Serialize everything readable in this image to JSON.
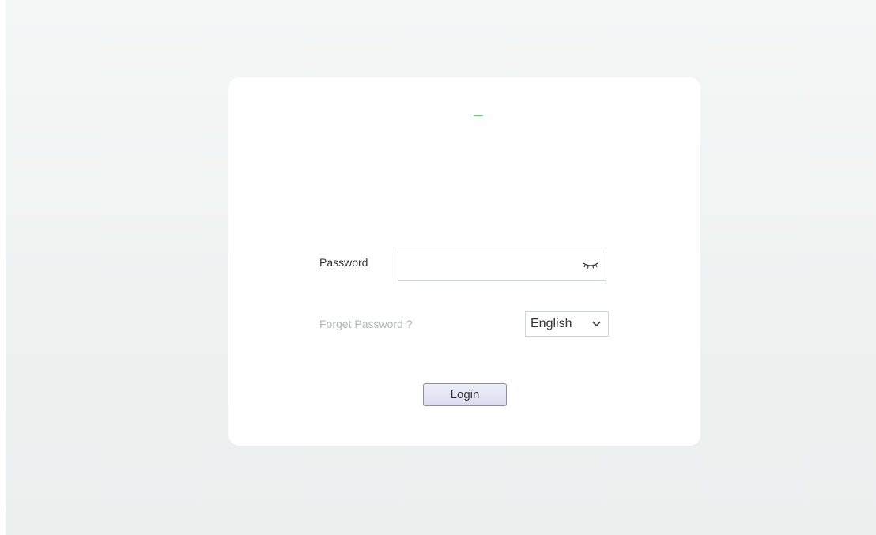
{
  "login": {
    "password_label": "Password",
    "password_value": "",
    "password_toggle_icon": "eye-closed-icon",
    "forgot_link": "Forget Password ?",
    "language": {
      "selected": "English",
      "icon": "chevron-down-icon"
    },
    "submit_label": "Login"
  },
  "colors": {
    "background": "#eef2f1",
    "card": "#ffffff",
    "logo_accent": "#5fd06a",
    "link_muted": "#b3b8b7",
    "button_fill": "#dcdcf0"
  }
}
